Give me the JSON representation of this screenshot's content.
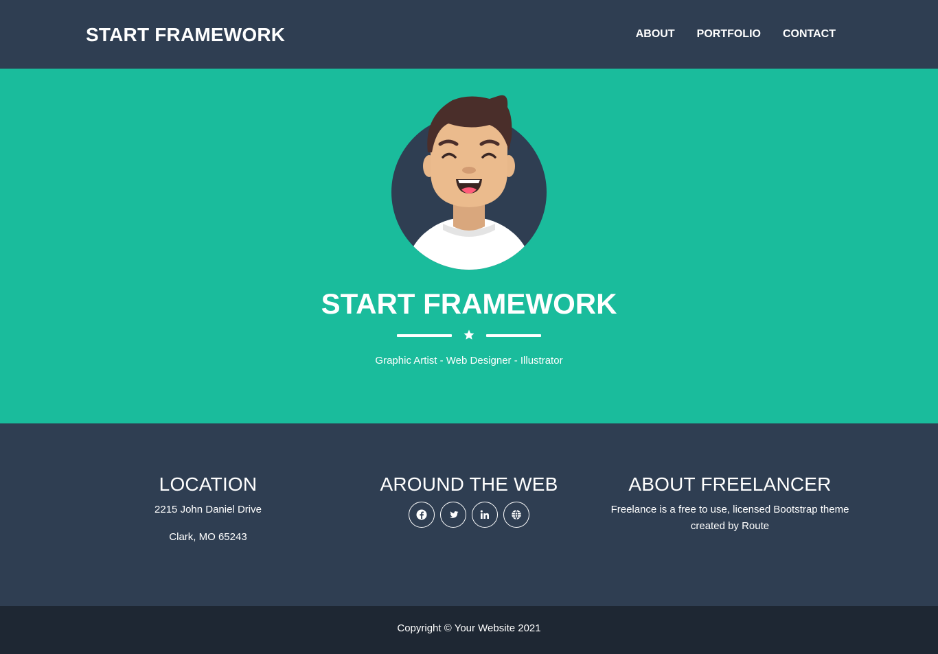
{
  "navbar": {
    "brand": "START FRAMEWORK",
    "links": [
      {
        "label": "ABOUT"
      },
      {
        "label": "PORTFOLIO"
      },
      {
        "label": "CONTACT"
      }
    ]
  },
  "hero": {
    "title": "START FRAMEWORK",
    "subtitle": "Graphic Artist - Web Designer - Illustrator",
    "avatar_icon": "avatar-icon",
    "divider_icon": "star-icon"
  },
  "footer": {
    "location": {
      "title": "LOCATION",
      "line1": "2215 John Daniel Drive",
      "line2": "Clark, MO 65243"
    },
    "web": {
      "title": "AROUND THE WEB",
      "icons": [
        "facebook-icon",
        "twitter-icon",
        "linkedin-icon",
        "globe-icon"
      ]
    },
    "about": {
      "title": "ABOUT FREELANCER",
      "text": "Freelance is a free to use, licensed Bootstrap theme created by Route"
    }
  },
  "copyright": {
    "text": "Copyright © Your Website 2021"
  },
  "colors": {
    "navbar": "#2f3e52",
    "hero": "#1abc9c",
    "footer": "#2f3e52",
    "copyright": "#1e2733"
  }
}
